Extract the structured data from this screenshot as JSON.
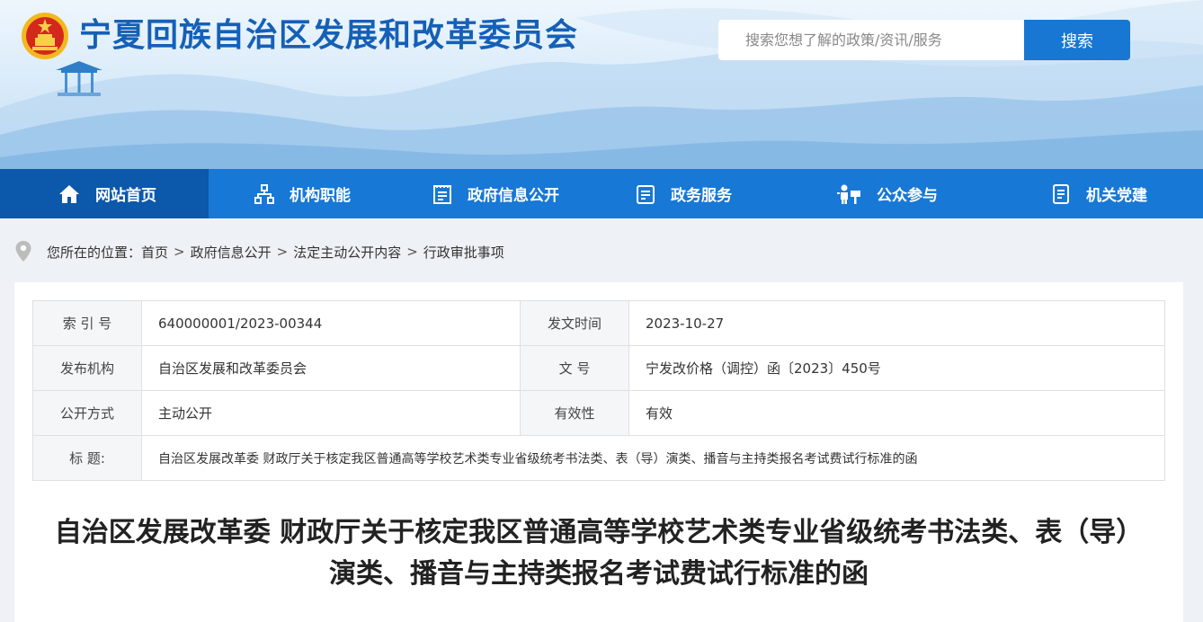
{
  "header": {
    "site_title": "宁夏回族自治区发展和改革委员会",
    "search_placeholder": "搜索您想了解的政策/资讯/服务",
    "search_button": "搜索"
  },
  "nav": {
    "items": [
      {
        "label": "网站首页",
        "icon": "home-icon"
      },
      {
        "label": "机构职能",
        "icon": "org-chart-icon"
      },
      {
        "label": "政府信息公开",
        "icon": "newspaper-icon"
      },
      {
        "label": "政务服务",
        "icon": "document-list-icon"
      },
      {
        "label": "公众参与",
        "icon": "people-icon"
      },
      {
        "label": "机关党建",
        "icon": "file-icon"
      }
    ]
  },
  "breadcrumb": {
    "prefix": "您所在的位置：",
    "items": [
      "首页",
      "政府信息公开",
      "法定主动公开内容",
      "行政审批事项"
    ],
    "separator": ">"
  },
  "meta": {
    "index_label": "索 引 号",
    "index_value": "640000001/2023-00344",
    "date_label": "发文时间",
    "date_value": "2023-10-27",
    "org_label": "发布机构",
    "org_value": "自治区发展和改革委员会",
    "docno_label": "文 号",
    "docno_value": "宁发改价格（调控）函〔2023〕450号",
    "mode_label": "公开方式",
    "mode_value": "主动公开",
    "validity_label": "有效性",
    "validity_value": "有效",
    "title_label": "标 题:",
    "title_value": "自治区发展改革委 财政厅关于核定我区普通高等学校艺术类专业省级统考书法类、表（导）演类、播音与主持类报名考试费试行标准的函"
  },
  "document": {
    "title": "自治区发展改革委 财政厅关于核定我区普通高等学校艺术类专业省级统考书法类、表（导）演类、播音与主持类报名考试费试行标准的函"
  },
  "colors": {
    "brand_blue": "#1778d6",
    "nav_active": "#0c58aa",
    "title_blue": "#1560b7"
  }
}
